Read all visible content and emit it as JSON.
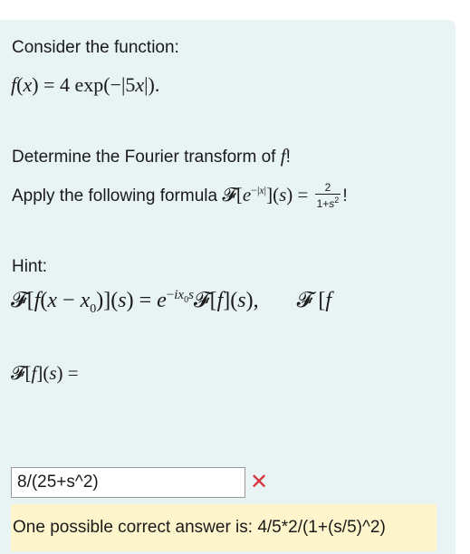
{
  "prompt": "Consider the function:",
  "task_line1_prefix": "Determine the Fourier transform of ",
  "task_line1_suffix": "!",
  "task_line2_prefix": "Apply the following formula ",
  "task_line2_suffix": "!",
  "hint_label": "Hint:",
  "answer_input": {
    "value": "8/(25+s^2)"
  },
  "feedback": {
    "status": "incorrect",
    "color": "#d9333f"
  },
  "solution_text": "One possible correct answer is: 4/5*2/(1+(s/5)^2)"
}
